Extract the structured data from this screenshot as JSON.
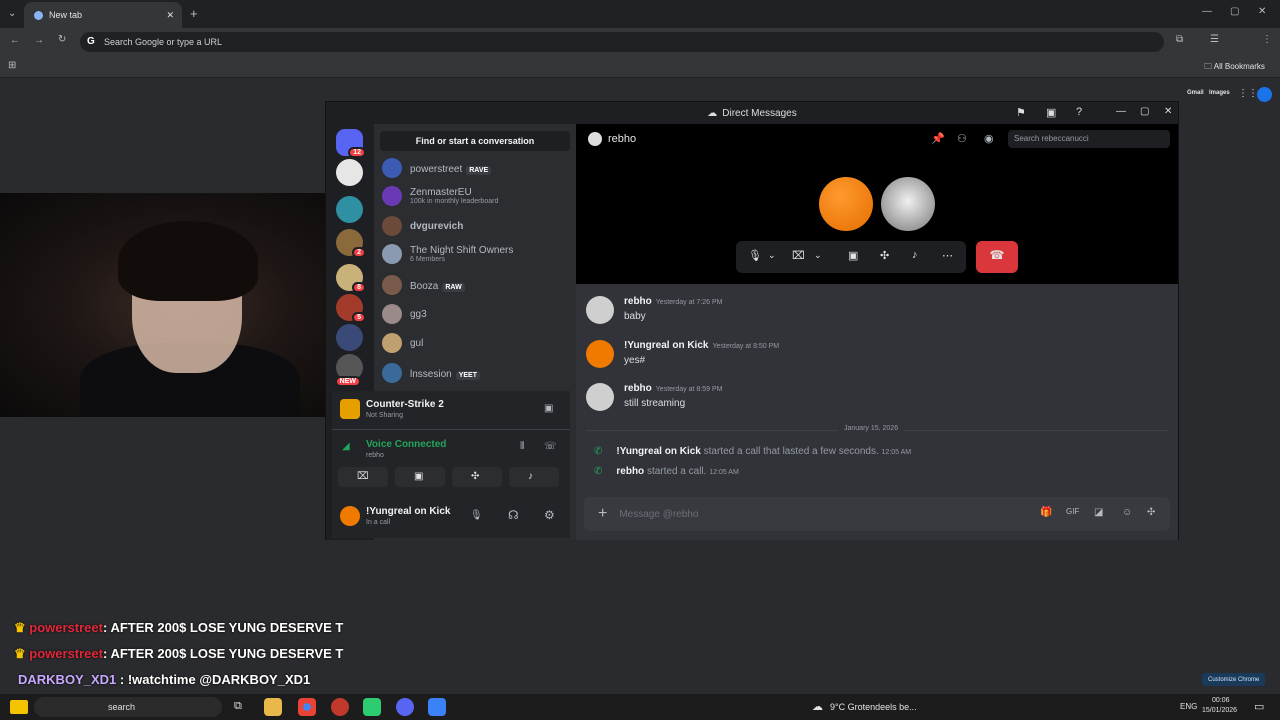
{
  "browser": {
    "tab_title": "New tab",
    "omnibox_placeholder": "Search Google or type a URL",
    "all_bookmarks": "All Bookmarks",
    "gmail": "Gmail",
    "images": "Images",
    "customize": "Customize Chrome"
  },
  "discord": {
    "window_title": "Direct Messages",
    "find_conversation": "Find or start a conversation",
    "servers": [
      {
        "badge": "12"
      },
      {
        "badge": ""
      },
      {
        "badge": ""
      },
      {
        "badge": "2"
      },
      {
        "badge": "8"
      },
      {
        "badge": "5"
      },
      {
        "badge": ""
      },
      {
        "badge": "NEW"
      }
    ],
    "dms": [
      {
        "name": "powerstreet",
        "tag": "RAVE",
        "sub": ""
      },
      {
        "name": "ZenmasterEU",
        "tag": "",
        "sub": "100k in monthly leaderboard"
      },
      {
        "name": "dvgurevich",
        "tag": "",
        "sub": ""
      },
      {
        "name": "The Night Shift Owners",
        "tag": "",
        "sub": "6 Members"
      },
      {
        "name": "Booza",
        "tag": "RAW",
        "sub": ""
      },
      {
        "name": "gg3",
        "tag": "",
        "sub": ""
      },
      {
        "name": "gul",
        "tag": "",
        "sub": ""
      },
      {
        "name": "lnssesion",
        "tag": "YEET",
        "sub": ""
      }
    ],
    "game": {
      "name": "Counter-Strike 2",
      "status": "Not Sharing"
    },
    "voice": {
      "status": "Voice Connected",
      "channel": "rebho"
    },
    "user": {
      "name": "!Yungreal on Kick",
      "status": "In a call"
    },
    "chat": {
      "header_name": "rebho",
      "search_placeholder": "Search rebeccanucci",
      "messages": [
        {
          "author": "rebho",
          "time": "Yesterday at 7:26 PM",
          "text": "baby"
        },
        {
          "author": "!Yungreal on Kick",
          "time": "Yesterday at 8:50 PM",
          "text": "yes#"
        },
        {
          "author": "rebho",
          "time": "Yesterday at 8:59 PM",
          "text": "still streaming"
        }
      ],
      "date_divider": "January 15, 2026",
      "system": [
        {
          "author": "!Yungreal on Kick",
          "text": "started a call that lasted a few seconds.",
          "time": "12:05 AM"
        },
        {
          "author": "rebho",
          "text": "started a call.",
          "time": "12:05 AM"
        }
      ],
      "composer_placeholder": "Message @rebho"
    }
  },
  "stream_chat": [
    {
      "user": "powerstreet",
      "text": ": AFTER 200$ LOSE YUNG DESERVE T",
      "color": "#e0283a"
    },
    {
      "user": "powerstreet",
      "text": ": AFTER 200$ LOSE YUNG DESERVE T",
      "color": "#e0283a"
    },
    {
      "user": "DARKBOY_XD1",
      "text": ": !watchtime @DARKBOY_XD1",
      "color": "#c9a8ff"
    }
  ],
  "taskbar": {
    "search": "search",
    "weather": "9°C  Grotendeels be...",
    "lang": "ENG",
    "time": "00:06",
    "date": "15/01/2026"
  },
  "colors": {
    "accent": "#5865f2",
    "green": "#23a55a",
    "red": "#da373c"
  }
}
